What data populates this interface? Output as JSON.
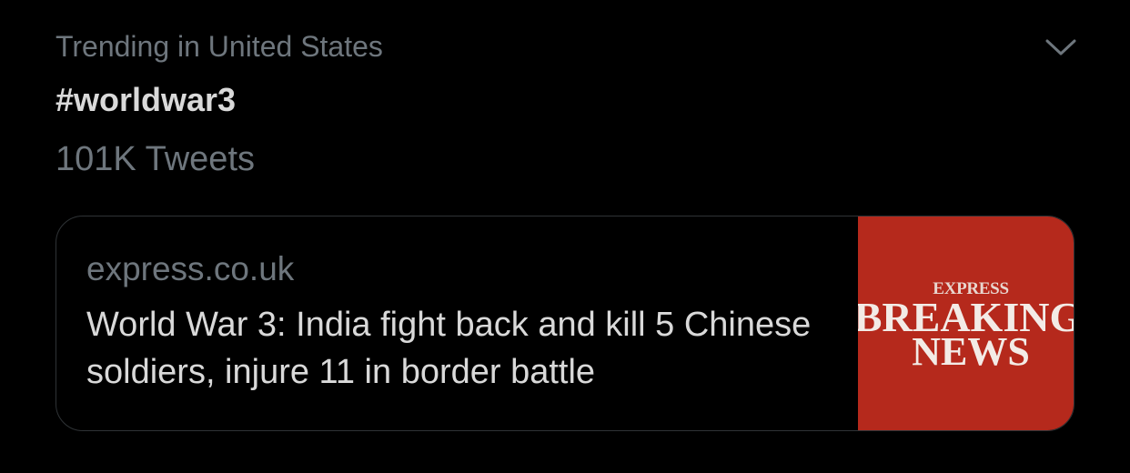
{
  "trend": {
    "context": "Trending in United States",
    "hashtag": "#worldwar3",
    "tweet_count": "101K Tweets",
    "menu_icon": "chevron-down-icon"
  },
  "card": {
    "domain": "express.co.uk",
    "headline": "World War 3: India fight back and kill 5 Chinese soldiers, injure 11 in border battle",
    "thumbnail": {
      "brand": "EXPRESS",
      "line1": "BREAKING",
      "line2": "NEWS",
      "background_color": "#b5291c"
    }
  },
  "colors": {
    "background": "#000000",
    "primary_text": "#d9d9d9",
    "secondary_text": "#6e767d",
    "card_border": "#2f3336"
  }
}
